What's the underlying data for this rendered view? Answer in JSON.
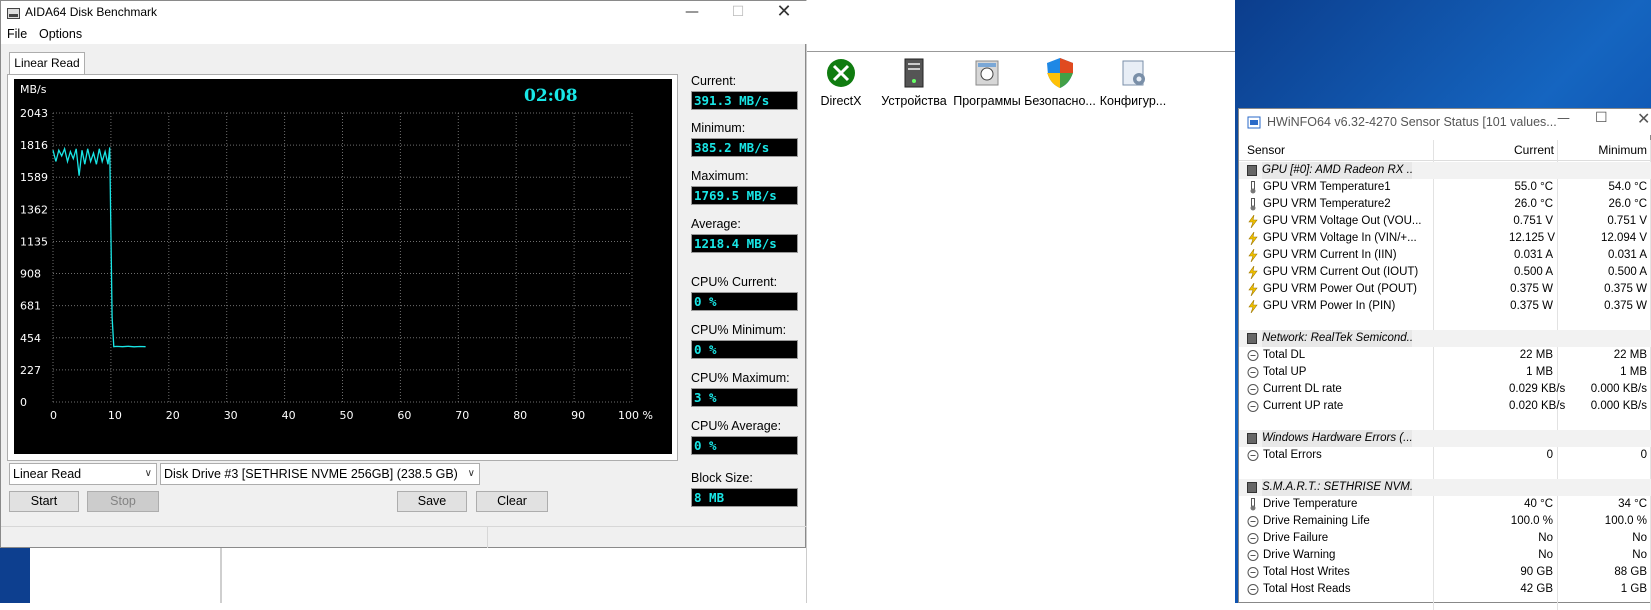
{
  "aida": {
    "title": "AIDA64 Disk Benchmark",
    "menu": [
      "File",
      "Options"
    ],
    "tab": "Linear Read",
    "timer": "02:08",
    "stats": [
      {
        "label": "Current:",
        "value": "391.3 MB/s"
      },
      {
        "label": "Minimum:",
        "value": "385.2 MB/s"
      },
      {
        "label": "Maximum:",
        "value": "1769.5 MB/s"
      },
      {
        "label": "Average:",
        "value": "1218.4 MB/s"
      },
      {
        "label": "CPU% Current:",
        "value": "0 %"
      },
      {
        "label": "CPU% Minimum:",
        "value": "0 %"
      },
      {
        "label": "CPU% Maximum:",
        "value": "3 %"
      },
      {
        "label": "CPU% Average:",
        "value": "0 %"
      },
      {
        "label": "Block Size:",
        "value": "8 MB"
      }
    ],
    "test_select": "Linear Read",
    "drive_select": "Disk Drive #3  [SETHRISE NVME 256GB]  (238.5 GB)",
    "buttons": {
      "start": "Start",
      "stop": "Stop",
      "save": "Save",
      "clear": "Clear"
    }
  },
  "chart_data": {
    "type": "line",
    "ylabel": "MB/s",
    "y_ticks": [
      "2043",
      "1816",
      "1589",
      "1362",
      "1135",
      "908",
      "681",
      "454",
      "227",
      "0"
    ],
    "x_ticks": [
      "0",
      "10",
      "20",
      "30",
      "40",
      "50",
      "60",
      "70",
      "80",
      "90",
      "100 %"
    ],
    "xlim": [
      0,
      100
    ],
    "ylim": [
      0,
      2043
    ],
    "grid": true,
    "line_color": "#19e6e6",
    "x": [
      0,
      0.5,
      1,
      1.5,
      2,
      2.5,
      3,
      3.5,
      4,
      4.5,
      5,
      5.5,
      6,
      6.5,
      7,
      7.5,
      8,
      8.5,
      9,
      9.5,
      9.8,
      10,
      10.2,
      10.5,
      11,
      12,
      13,
      14,
      15,
      16
    ],
    "values": [
      1780,
      1700,
      1780,
      1740,
      1790,
      1700,
      1770,
      1720,
      1790,
      1600,
      1780,
      1680,
      1790,
      1700,
      1760,
      1680,
      1790,
      1700,
      1770,
      1680,
      1800,
      1200,
      600,
      391,
      393,
      391,
      394,
      390,
      392,
      391
    ]
  },
  "explorer": {
    "tiles": [
      {
        "label": "DirectX",
        "icon": "xbox-icon",
        "color": "#107c10"
      },
      {
        "label": "Устройства",
        "icon": "server-icon",
        "color": "#555555"
      },
      {
        "label": "Программы",
        "icon": "programs-icon",
        "color": "#8a8a8a"
      },
      {
        "label": "Безопасно...",
        "icon": "shield-icon",
        "color": "#e04a1f"
      },
      {
        "label": "Конфигур...",
        "icon": "config-icon",
        "color": "#7a8fa8"
      }
    ]
  },
  "hwinfo": {
    "title": "HWiNFO64 v6.32-4270 Sensor Status [101 values...",
    "columns": {
      "sensor": "Sensor",
      "current": "Current",
      "minimum": "Minimum"
    },
    "groups": [
      {
        "name": "GPU [#0]: AMD Radeon RX ...",
        "rows": [
          {
            "icon": "thermometer-icon",
            "name": "GPU VRM Temperature1",
            "current": "55.0 °C",
            "minimum": "54.0 °C"
          },
          {
            "icon": "thermometer-icon",
            "name": "GPU VRM Temperature2",
            "current": "26.0 °C",
            "minimum": "26.0 °C"
          },
          {
            "icon": "lightning-icon",
            "name": "GPU VRM Voltage Out (VOU...",
            "current": "0.751 V",
            "minimum": "0.751 V"
          },
          {
            "icon": "lightning-icon",
            "name": "GPU VRM Voltage In (VIN/+...",
            "current": "12.125 V",
            "minimum": "12.094 V"
          },
          {
            "icon": "lightning-icon",
            "name": "GPU VRM Current In (IIN)",
            "current": "0.031 A",
            "minimum": "0.031 A"
          },
          {
            "icon": "lightning-icon",
            "name": "GPU VRM Current Out (IOUT)",
            "current": "0.500 A",
            "minimum": "0.500 A"
          },
          {
            "icon": "lightning-icon",
            "name": "GPU VRM Power Out (POUT)",
            "current": "0.375 W",
            "minimum": "0.375 W"
          },
          {
            "icon": "lightning-icon",
            "name": "GPU VRM Power In (PIN)",
            "current": "0.375 W",
            "minimum": "0.375 W"
          }
        ]
      },
      {
        "name": "Network: RealTek Semicond...",
        "rows": [
          {
            "icon": "circle-icon",
            "name": "Total DL",
            "current": "22 MB",
            "minimum": "22 MB"
          },
          {
            "icon": "circle-icon",
            "name": "Total UP",
            "current": "1 MB",
            "minimum": "1 MB"
          },
          {
            "icon": "circle-icon",
            "name": "Current DL rate",
            "current": "0.029 KB/s",
            "minimum": "0.000 KB/s"
          },
          {
            "icon": "circle-icon",
            "name": "Current UP rate",
            "current": "0.020 KB/s",
            "minimum": "0.000 KB/s"
          }
        ]
      },
      {
        "name": "Windows Hardware Errors (...",
        "rows": [
          {
            "icon": "circle-icon",
            "name": "Total Errors",
            "current": "0",
            "minimum": "0"
          }
        ]
      },
      {
        "name": "S.M.A.R.T.: SETHRISE NVM...",
        "rows": [
          {
            "icon": "thermometer-icon",
            "name": "Drive Temperature",
            "current": "40 °C",
            "minimum": "34 °C"
          },
          {
            "icon": "circle-icon",
            "name": "Drive Remaining Life",
            "current": "100.0 %",
            "minimum": "100.0 %"
          },
          {
            "icon": "circle-icon",
            "name": "Drive Failure",
            "current": "No",
            "minimum": "No"
          },
          {
            "icon": "circle-icon",
            "name": "Drive Warning",
            "current": "No",
            "minimum": "No"
          },
          {
            "icon": "circle-icon",
            "name": "Total Host Writes",
            "current": "90 GB",
            "minimum": "88 GB"
          },
          {
            "icon": "circle-icon",
            "name": "Total Host Reads",
            "current": "42 GB",
            "minimum": "1 GB"
          }
        ]
      }
    ]
  }
}
